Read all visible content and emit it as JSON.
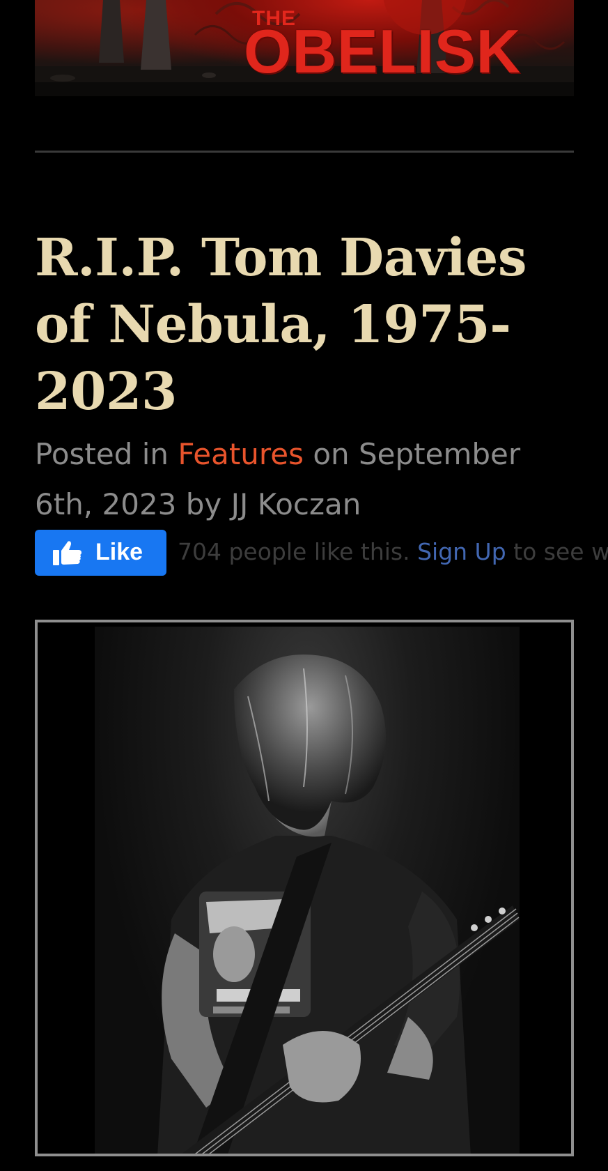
{
  "banner": {
    "logo_small": "THE",
    "logo_large": "OBELISK"
  },
  "post": {
    "title": "R.I.P. Tom Davies of Nebula, 1975-2023",
    "meta_prefix": "Posted in ",
    "category": "Features",
    "meta_suffix": " on September 6th, 2023 by JJ Koczan"
  },
  "facebook": {
    "like_label": "Like",
    "count_text": "704 people like this.",
    "signup_label": "Sign Up",
    "trailing_text": " to see wh",
    "brand_color": "#1877f2",
    "thumb_icon": "thumbs-up-icon"
  },
  "colors": {
    "title": "#e8d9b0",
    "meta": "#8c8c8c",
    "link": "#e8542c",
    "banner_red": "#e0261c"
  }
}
